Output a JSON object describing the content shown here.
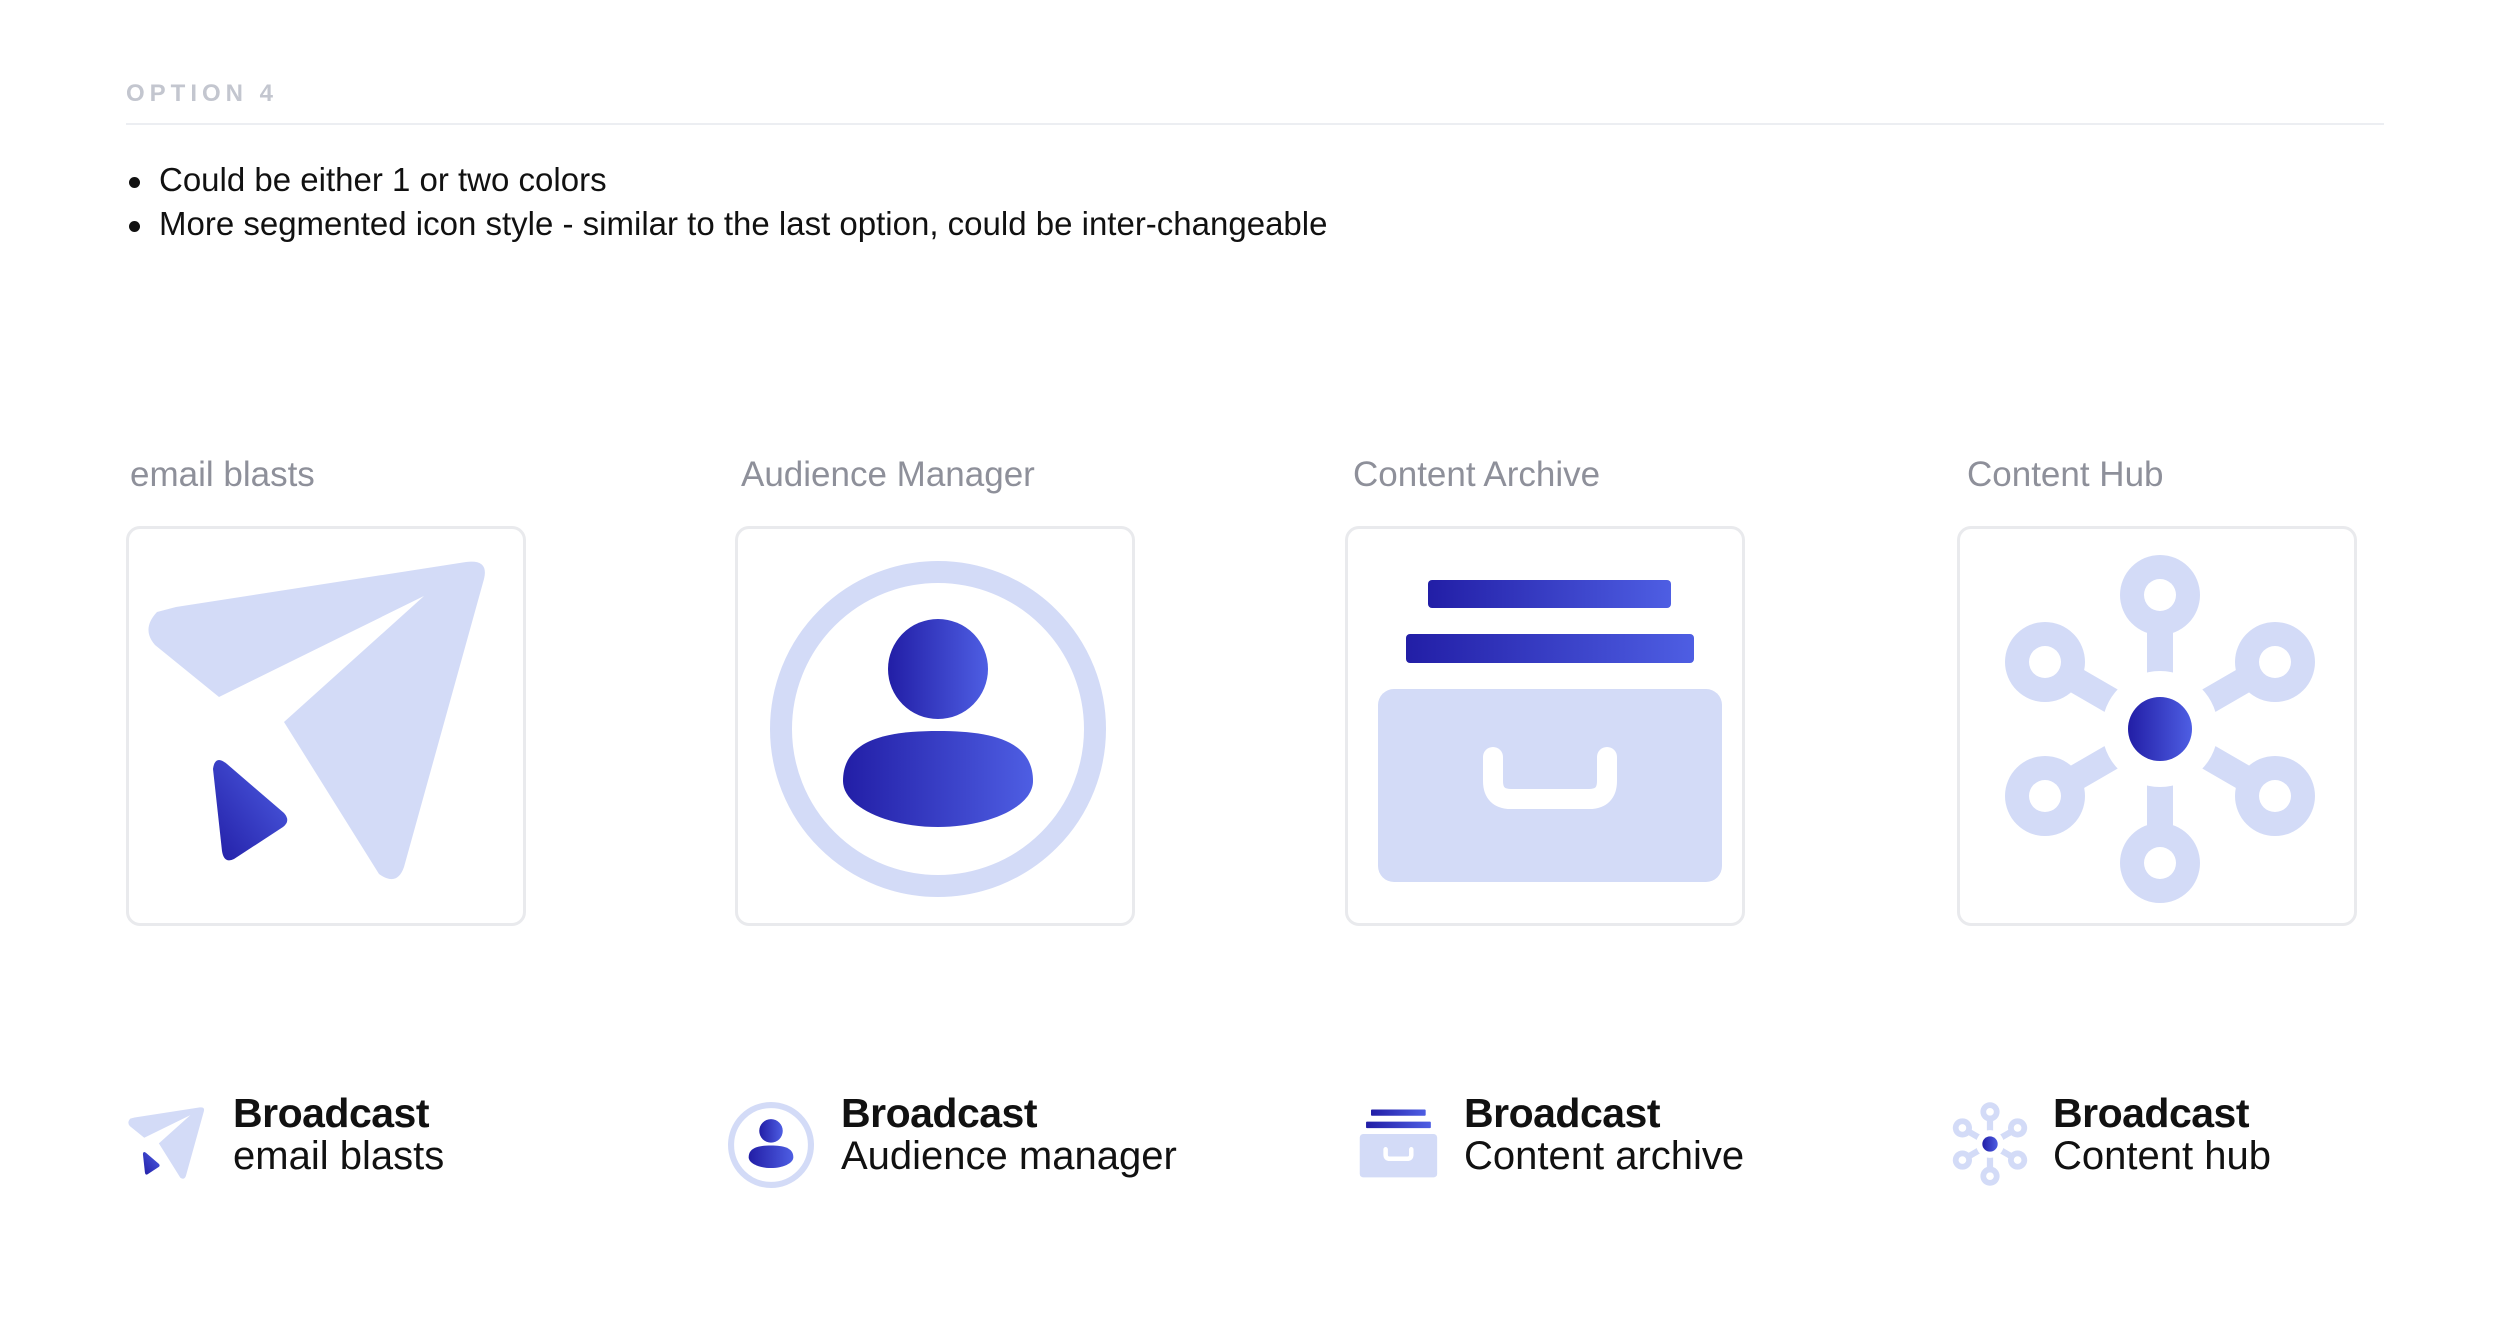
{
  "header": {
    "option_label": "OPTION 4",
    "bullets": [
      "Could be either 1 or two colors",
      "More segmented icon style - similar to the last option, could be inter-changeable"
    ]
  },
  "colors": {
    "light_fill": "#d3dbf7",
    "gradient_start": "#221ea6",
    "gradient_end": "#4e5ee3",
    "card_border": "#e9eaed",
    "title_gray": "#8e909a"
  },
  "cards": [
    {
      "title": "email blasts",
      "icon": "paper-plane-icon"
    },
    {
      "title": "Audience Manager",
      "icon": "user-circle-icon"
    },
    {
      "title": "Content Archive",
      "icon": "archive-box-icon"
    },
    {
      "title": "Content Hub",
      "icon": "hub-network-icon"
    }
  ],
  "lockups": [
    {
      "brand": "Broadcast",
      "product": "email blasts",
      "icon": "paper-plane-icon"
    },
    {
      "brand": "Broadcast",
      "product": "Audience manager",
      "icon": "user-circle-icon"
    },
    {
      "brand": "Broadcast",
      "product": "Content archive",
      "icon": "archive-box-icon"
    },
    {
      "brand": "Broadcast",
      "product": "Content hub",
      "icon": "hub-network-icon"
    }
  ]
}
